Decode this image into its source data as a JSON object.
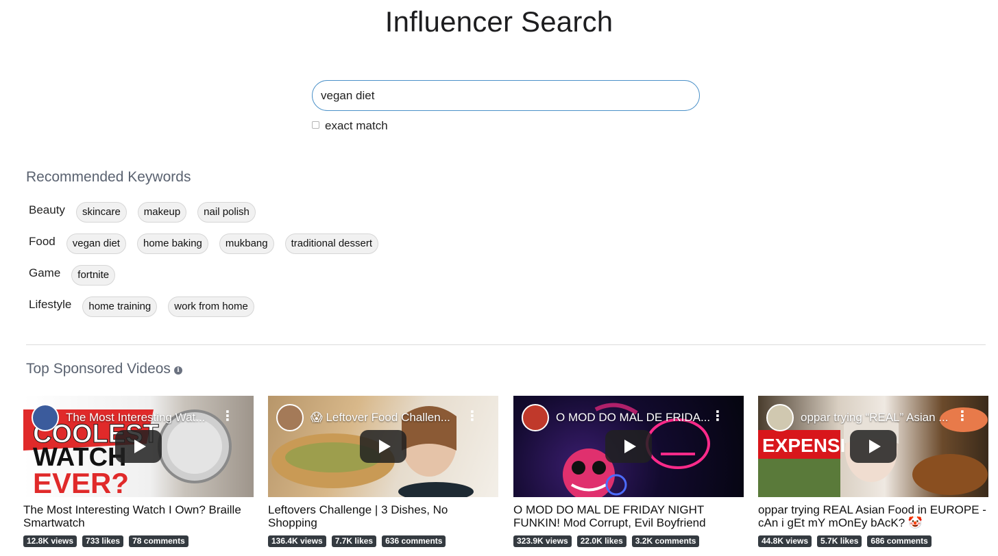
{
  "page": {
    "title": "Influencer Search"
  },
  "search": {
    "value": "vegan diet",
    "exact_label": "exact match"
  },
  "recommended": {
    "title": "Recommended Keywords",
    "groups": [
      {
        "category": "Beauty",
        "keywords": [
          "skincare",
          "makeup",
          "nail polish"
        ]
      },
      {
        "category": "Food",
        "keywords": [
          "vegan diet",
          "home baking",
          "mukbang",
          "traditional dessert"
        ]
      },
      {
        "category": "Game",
        "keywords": [
          "fortnite"
        ]
      },
      {
        "category": "Lifestyle",
        "keywords": [
          "home training",
          "work from home"
        ]
      }
    ]
  },
  "sponsored": {
    "title": "Top Sponsored Videos",
    "info_icon": "info-icon",
    "videos": [
      {
        "thumb_title": "The Most Interesting Wat...",
        "title": "The Most Interesting Watch I Own? Braille Smartwatch",
        "views": "12.8K views",
        "likes": "733 likes",
        "comments": "78 comments"
      },
      {
        "thumb_title": "😱 Leftover Food Challen...",
        "title": "Leftovers Challenge | 3 Dishes, No Shopping",
        "views": "136.4K views",
        "likes": "7.7K likes",
        "comments": "636 comments"
      },
      {
        "thumb_title": "O MOD DO MAL DE FRIDA...",
        "title": "O MOD DO MAL DE FRIDAY NIGHT FUNKIN! Mod Corrupt, Evil Boyfriend",
        "views": "323.9K views",
        "likes": "22.0K likes",
        "comments": "3.2K comments"
      },
      {
        "thumb_title": "oppar trying “REAL” Asian ...",
        "title": "oppar trying REAL Asian Food in EUROPE - cAn i gEt mY mOnEy bAcK? 🤡",
        "views": "44.8K views",
        "likes": "5.7K likes",
        "comments": "686 comments"
      }
    ]
  },
  "colors": {
    "input_border": "#4a90c8",
    "stat_bg": "#343a40",
    "chip_bg": "#f1f1f1",
    "section_title": "#5a6270"
  }
}
